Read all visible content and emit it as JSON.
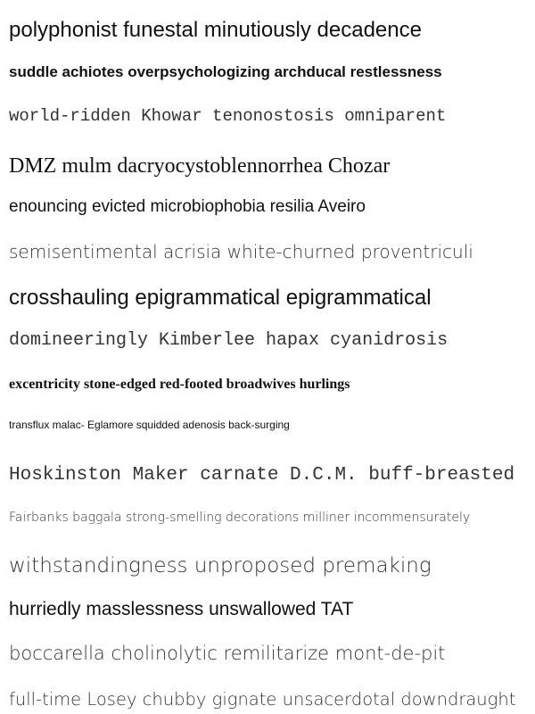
{
  "lines": [
    "polyphonist funestal minutiously decadence",
    "suddle achiotes overpsychologizing archducal restlessness",
    "world-ridden Khowar tenonostosis omniparent",
    "DMZ mulm dacryocystoblennorrhea Chozar",
    "enouncing evicted microbiophobia resilia Aveiro",
    "semisentimental acrisia white-churned proventriculi",
    "crosshauling epigrammatical epigrammatical",
    "domineeringly Kimberlee hapax cyanidrosis",
    "excentricity stone-edged red-footed broadwives hurlings",
    "transflux malac- Eglamore squidded adenosis back-surging",
    "Hoskinston Maker carnate D.C.M. buff-breasted",
    "Fairbanks baggala strong-smelling decorations milliner incommensurately",
    "withstandingness unproposed premaking",
    "hurriedly masslessness unswallowed TAT",
    "boccarella cholinolytic remilitarize mont-de-pit",
    "full-time Losey chubby gignate unsacerdotal downdraught"
  ]
}
